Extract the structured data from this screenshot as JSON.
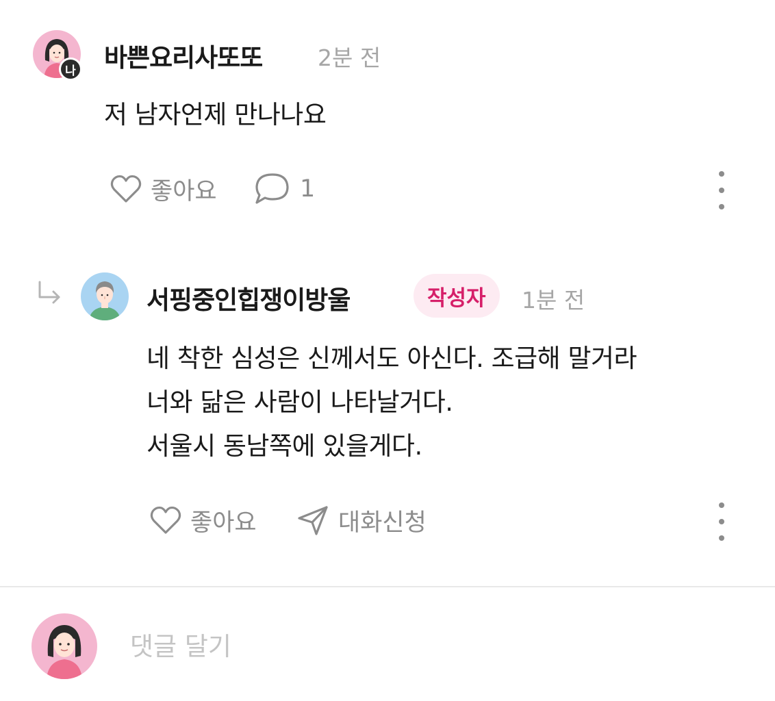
{
  "comment": {
    "username": "바쁜요리사또또",
    "time": "2분 전",
    "me_badge": "나",
    "text": "저 남자언제 만나나요",
    "like_label": "좋아요",
    "reply_count": "1"
  },
  "reply": {
    "username": "서핑중인힙쟁이방울",
    "author_badge": "작성자",
    "time": "1분 전",
    "lines": [
      "네 착한 심성은 신께서도 아신다. 조급해 말거라",
      "너와 닮은 사람이 나타날거다.",
      "서울시 동남쪽에 있을게다."
    ],
    "like_label": "좋아요",
    "chat_label": "대화신청"
  },
  "composer": {
    "placeholder": "댓글 달기"
  },
  "colors": {
    "accent_pink": "#d61f69",
    "badge_bg": "#fdebf2",
    "muted": "#8c8c8c"
  },
  "icons": {
    "heart": "heart-icon",
    "speech_bubble": "comment-icon",
    "paper_plane": "send-icon",
    "more": "more-vertical-icon",
    "reply_arrow": "reply-arrow-icon"
  }
}
